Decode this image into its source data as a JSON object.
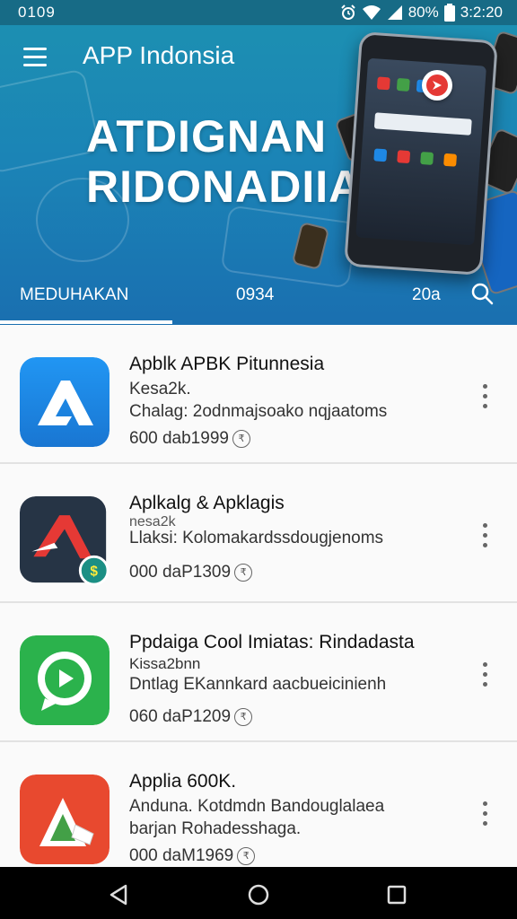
{
  "status_bar": {
    "time": "0109",
    "battery_text": "80%",
    "clock": "3:2:20"
  },
  "app_bar": {
    "title": "APP Indonsia"
  },
  "banner": {
    "hero_line_1": "ATDIGNAN",
    "hero_line_2": "RIDONADIIA"
  },
  "tabs": [
    {
      "label": "MEDUHAKAN",
      "selected": true
    },
    {
      "label": "0934",
      "selected": false
    },
    {
      "label": "20a",
      "selected": false
    }
  ],
  "apps": [
    {
      "title": "Apblk APBK Pitunnesia",
      "line1": "Kesa2k.",
      "line2": "Chalag: 2odnmajsoako nqjaatoms",
      "meta": "600 dab1999",
      "icon": "blue-a-logo-icon"
    },
    {
      "title": "Aplkalg & Apklagis",
      "line1": "Llaksi: Kolomakardssdougjenoms",
      "line2": "",
      "meta": "000 daP1309",
      "icon": "dark-a-logo-icon",
      "overlap_line": "nesa2k"
    },
    {
      "title": "Ppdaiga Cool Imiatas: Rindadasta",
      "line1": "Kissa2bnn",
      "line2": "Dntlag EKannkard aacbueicinienh",
      "meta": "060 daP1209",
      "icon": "green-chat-icon"
    },
    {
      "title": "Applia 600K.",
      "line1": "Anduna. Kotdmdn Bandouglalaea",
      "line2": "barjan Rohadesshaga.",
      "meta": "000 daM1969",
      "icon": "red-triangle-icon"
    }
  ],
  "accent_colors": {
    "banner": "#1b84b6",
    "status": "#176b86",
    "blue_icon": "#1e88e5",
    "dark_icon": "#263445",
    "green_icon": "#2bb24c",
    "red_icon": "#e8492f"
  }
}
